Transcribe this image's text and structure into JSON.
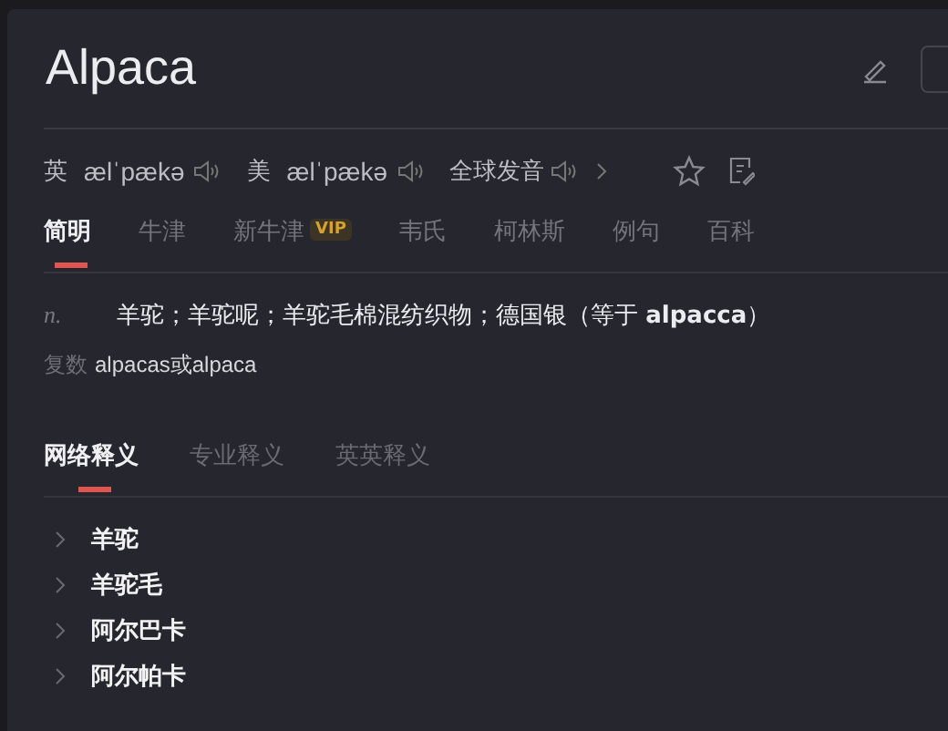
{
  "word": {
    "title": "Alpaca"
  },
  "pronunciations": [
    {
      "region": "英",
      "phonetic": "ælˈpækə"
    },
    {
      "region": "美",
      "phonetic": "ælˈpækə"
    }
  ],
  "global_pronunciation": {
    "label": "全球发音"
  },
  "dict_tabs": [
    {
      "label": "简明",
      "selected": true
    },
    {
      "label": "牛津",
      "selected": false
    },
    {
      "label": "新牛津",
      "selected": false,
      "badge": "VIP"
    },
    {
      "label": "韦氏",
      "selected": false
    },
    {
      "label": "柯林斯",
      "selected": false
    },
    {
      "label": "例句",
      "selected": false
    },
    {
      "label": "百科",
      "selected": false
    }
  ],
  "definitions": [
    {
      "pos": "n.",
      "text": "羊驼；羊驼呢；羊驼毛棉混纺织物；德国银（等于 **alpacca**）"
    }
  ],
  "plural": {
    "label": "复数",
    "value": "alpacas或alpaca"
  },
  "meaning_tabs": [
    {
      "label": "网络释义",
      "selected": true
    },
    {
      "label": "专业释义",
      "selected": false
    },
    {
      "label": "英英释义",
      "selected": false
    }
  ],
  "web_meanings": [
    {
      "text": "羊驼",
      "expanded": false
    },
    {
      "text": "羊驼毛",
      "expanded": false
    },
    {
      "text": "阿尔巴卡",
      "expanded": false
    },
    {
      "text": "阿尔帕卡",
      "expanded": false
    }
  ]
}
